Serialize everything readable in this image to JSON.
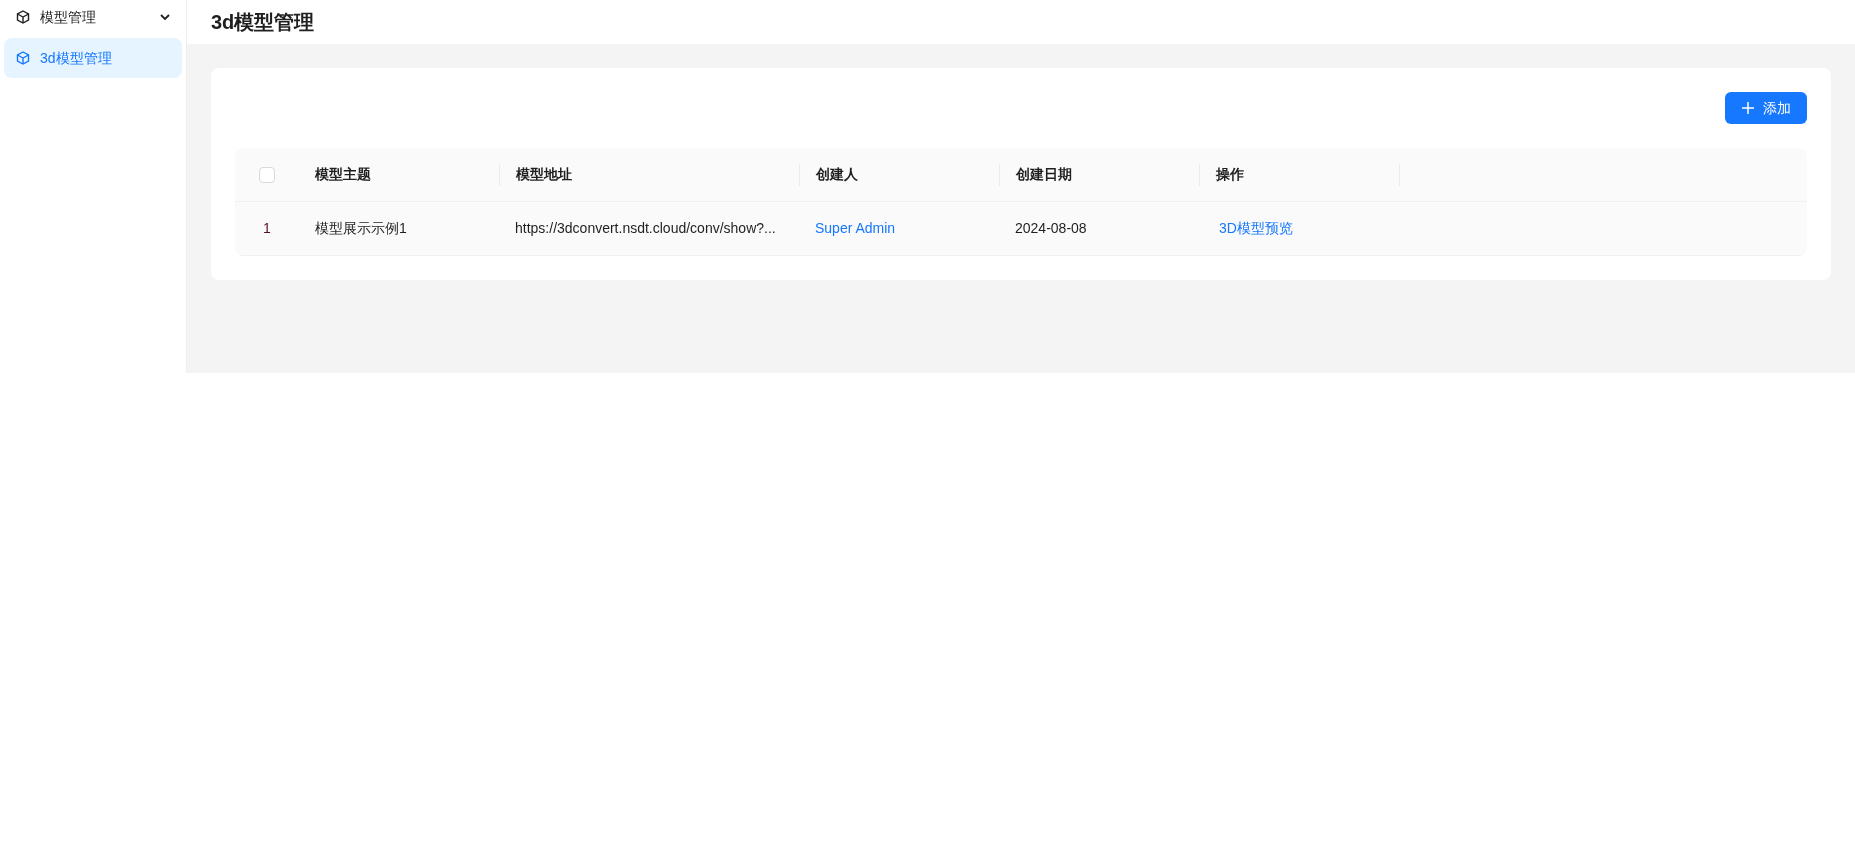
{
  "sidebar": {
    "items": [
      {
        "label": "模型管理",
        "kind": "group",
        "expanded": true,
        "selected": false
      },
      {
        "label": "3d模型管理",
        "kind": "item",
        "selected": true
      }
    ]
  },
  "page_title": "3d模型管理",
  "toolbar": {
    "add_button": "添加"
  },
  "table": {
    "select_all_checked": false,
    "columns": [
      "模型主题",
      "模型地址",
      "创建人",
      "创建日期",
      "操作"
    ],
    "rows": [
      {
        "index": "1",
        "cells": [
          {
            "text": "模型展示示例1",
            "kind": "text"
          },
          {
            "text": "https://3dconvert.nsdt.cloud/conv/show?...",
            "kind": "text"
          },
          {
            "text": "Super Admin",
            "kind": "accent"
          },
          {
            "text": "2024-08-08",
            "kind": "text"
          },
          {
            "text": "3D模型预览",
            "kind": "link"
          }
        ]
      }
    ]
  }
}
